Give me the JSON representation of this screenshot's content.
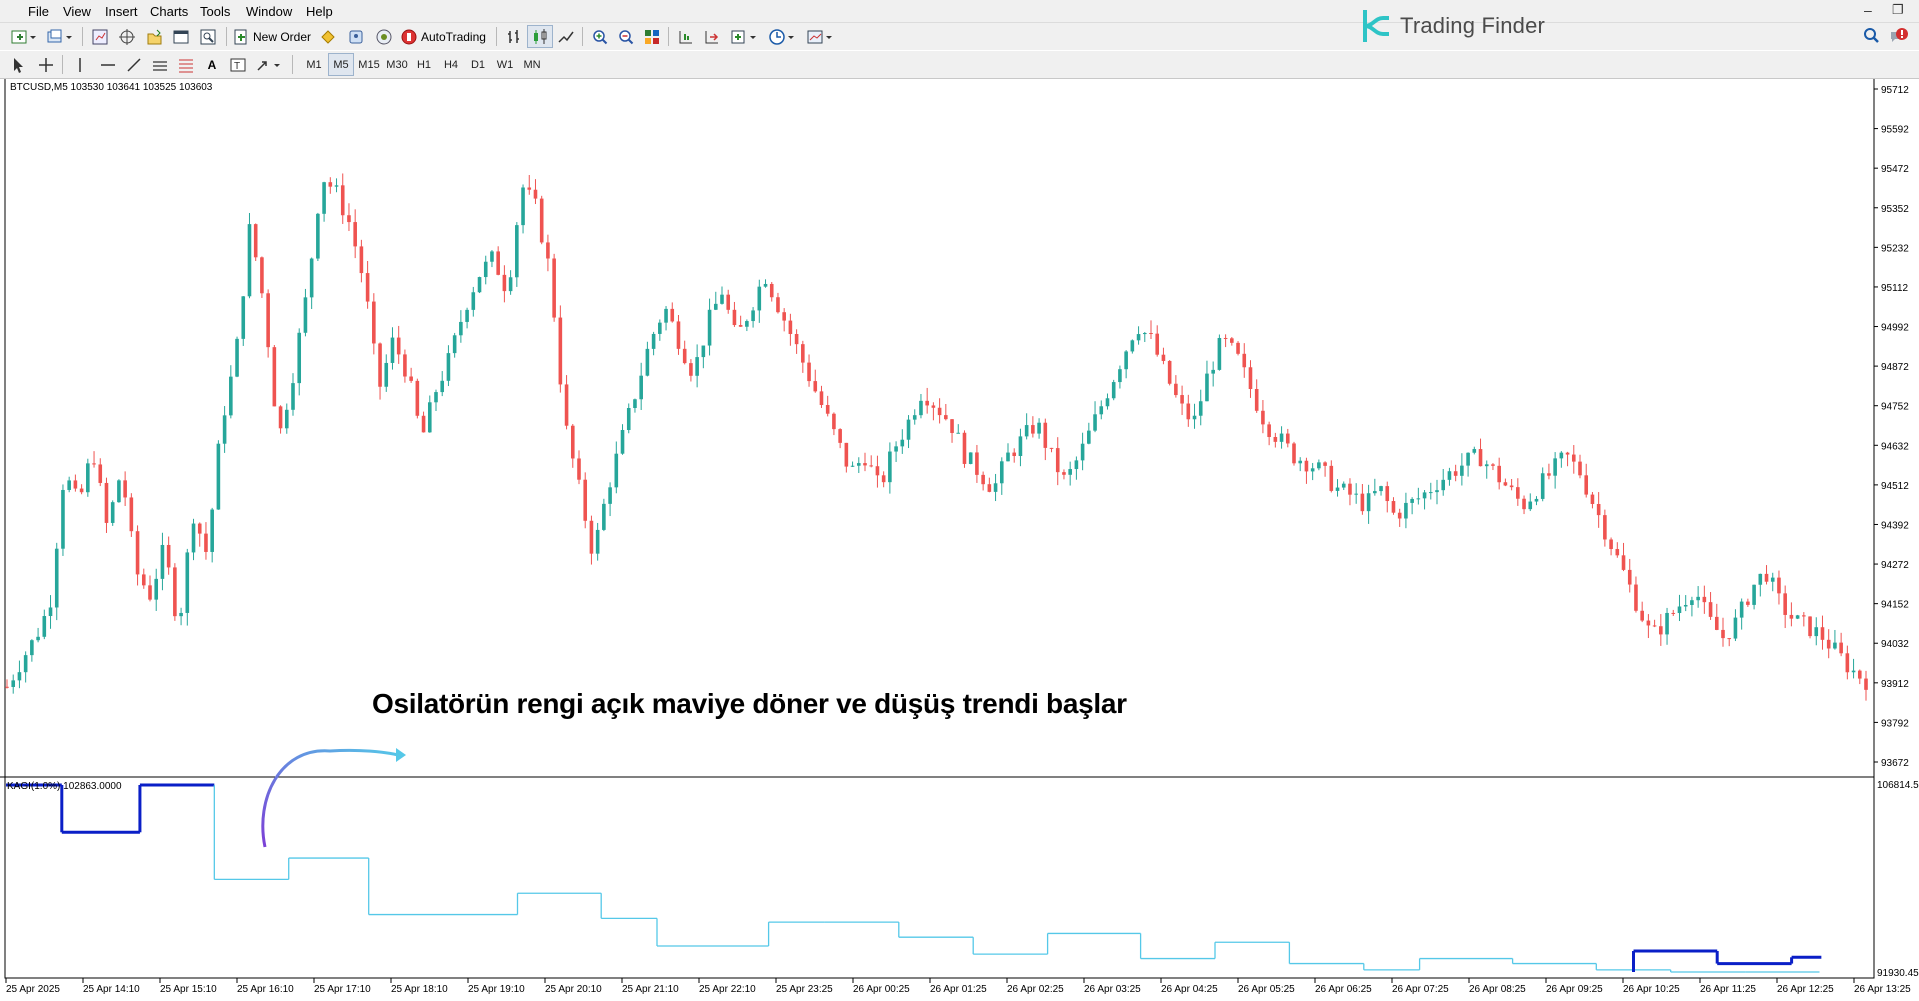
{
  "menu": [
    "File",
    "View",
    "Insert",
    "Charts",
    "Tools",
    "Window",
    "Help"
  ],
  "toolbar": {
    "new_order_label": "New Order",
    "autotrading_label": "AutoTrading",
    "timeframes": [
      "M1",
      "M5",
      "M15",
      "M30",
      "H1",
      "H4",
      "D1",
      "W1",
      "MN"
    ],
    "active_timeframe": "M5"
  },
  "brand": {
    "name": "Trading Finder",
    "accent": "#2ec4c6"
  },
  "chart": {
    "symbol_header": "BTCUSD,M5  103530 103641 103525 103603",
    "indicator_header": "KAGI(1.0%) 102863.0000",
    "annotation": "Osilatörün rengi açık maviye döner ve düşüş trendi başlar",
    "price_labels": [
      "95712",
      "95592",
      "95472",
      "95352",
      "95232",
      "95112",
      "94992",
      "94872",
      "94752",
      "94632",
      "94512",
      "94392",
      "94272",
      "94152",
      "94032",
      "93912",
      "93792",
      "93672"
    ],
    "price_range": [
      93672,
      95712
    ],
    "indicator_labels": [
      "106814.5",
      "91930.45"
    ],
    "time_labels": [
      "25 Apr 2025",
      "25 Apr 14:10",
      "25 Apr 15:10",
      "25 Apr 16:10",
      "25 Apr 17:10",
      "25 Apr 18:10",
      "25 Apr 19:10",
      "25 Apr 20:10",
      "25 Apr 21:10",
      "25 Apr 22:10",
      "25 Apr 23:25",
      "26 Apr 00:25",
      "26 Apr 01:25",
      "26 Apr 02:25",
      "26 Apr 03:25",
      "26 Apr 04:25",
      "26 Apr 05:25",
      "26 Apr 06:25",
      "26 Apr 07:25",
      "26 Apr 08:25",
      "26 Apr 09:25",
      "26 Apr 10:25",
      "26 Apr 11:25",
      "26 Apr 12:25",
      "26 Apr 13:25"
    ],
    "colors": {
      "bull": "#26a69a",
      "bear": "#ef5350",
      "kagi_thick": "#0a1fc7",
      "kagi_thin": "#55c8e8",
      "arrow": "#7b3fd6"
    },
    "close_path": [
      93900,
      93980,
      94050,
      94150,
      94550,
      94450,
      94620,
      94380,
      94560,
      94250,
      94180,
      94320,
      94080,
      94430,
      94300,
      94700,
      94900,
      95300,
      95050,
      94650,
      94850,
      95100,
      95450,
      95400,
      95300,
      95120,
      94800,
      94950,
      94850,
      94650,
      94800,
      94900,
      95050,
      95150,
      95200,
      95100,
      95420,
      95350,
      95150,
      94700,
      94500,
      94300,
      94500,
      94650,
      94800,
      94950,
      95050,
      94950,
      94850,
      95000,
      95100,
      94950,
      95050,
      95150,
      95050,
      94950,
      94850,
      94750,
      94650,
      94550,
      94600,
      94500,
      94620,
      94700,
      94800,
      94750,
      94700,
      94600,
      94550,
      94500,
      94600,
      94650,
      94700,
      94600,
      94520,
      94600,
      94700,
      94800,
      94900,
      95000,
      94950,
      94850,
      94750,
      94700,
      94850,
      94950,
      94900,
      94800,
      94700,
      94650,
      94600,
      94580,
      94550,
      94500,
      94480,
      94450,
      94500,
      94420,
      94450,
      94480,
      94520,
      94550,
      94580,
      94600,
      94550,
      94500,
      94450,
      94500,
      94550,
      94600,
      94550,
      94450,
      94350,
      94250,
      94150,
      94050,
      94100,
      94150,
      94200,
      94100,
      94050,
      94100,
      94200,
      94250,
      94150,
      94100,
      94080,
      94050,
      94000,
      93950,
      93920
    ]
  },
  "kagi": {
    "steps": [
      {
        "x0": 0,
        "x1": 0.03,
        "level": 106814,
        "color": "thick"
      },
      {
        "x0": 0.03,
        "x1": 0.072,
        "level": 103050,
        "color": "thick"
      },
      {
        "x0": 0.072,
        "x1": 0.112,
        "level": 106814,
        "color": "thick"
      },
      {
        "x0": 0.112,
        "x1": 0.152,
        "level": 99300,
        "color": "thin"
      },
      {
        "x0": 0.152,
        "x1": 0.195,
        "level": 101000,
        "color": "thin"
      },
      {
        "x0": 0.195,
        "x1": 0.275,
        "level": 96500,
        "color": "thin"
      },
      {
        "x0": 0.275,
        "x1": 0.32,
        "level": 98200,
        "color": "thin"
      },
      {
        "x0": 0.32,
        "x1": 0.35,
        "level": 96200,
        "color": "thin"
      },
      {
        "x0": 0.35,
        "x1": 0.41,
        "level": 94000,
        "color": "thin"
      },
      {
        "x0": 0.41,
        "x1": 0.44,
        "level": 95900,
        "color": "thin"
      },
      {
        "x0": 0.44,
        "x1": 0.48,
        "level": 95900,
        "color": "thin"
      },
      {
        "x0": 0.48,
        "x1": 0.52,
        "level": 94700,
        "color": "thin"
      },
      {
        "x0": 0.52,
        "x1": 0.56,
        "level": 93350,
        "color": "thin"
      },
      {
        "x0": 0.56,
        "x1": 0.61,
        "level": 95000,
        "color": "thin"
      },
      {
        "x0": 0.61,
        "x1": 0.65,
        "level": 93000,
        "color": "thin"
      },
      {
        "x0": 0.65,
        "x1": 0.69,
        "level": 94300,
        "color": "thin"
      },
      {
        "x0": 0.69,
        "x1": 0.73,
        "level": 92600,
        "color": "thin"
      },
      {
        "x0": 0.73,
        "x1": 0.76,
        "level": 92100,
        "color": "thin"
      },
      {
        "x0": 0.76,
        "x1": 0.81,
        "level": 93000,
        "color": "thin"
      },
      {
        "x0": 0.81,
        "x1": 0.855,
        "level": 92600,
        "color": "thin"
      },
      {
        "x0": 0.855,
        "x1": 0.895,
        "level": 92100,
        "color": "thin"
      },
      {
        "x0": 0.895,
        "x1": 0.935,
        "level": 91930,
        "color": "thin"
      },
      {
        "x0": 0.935,
        "x1": 0.975,
        "level": 91930,
        "color": "thin"
      }
    ]
  }
}
